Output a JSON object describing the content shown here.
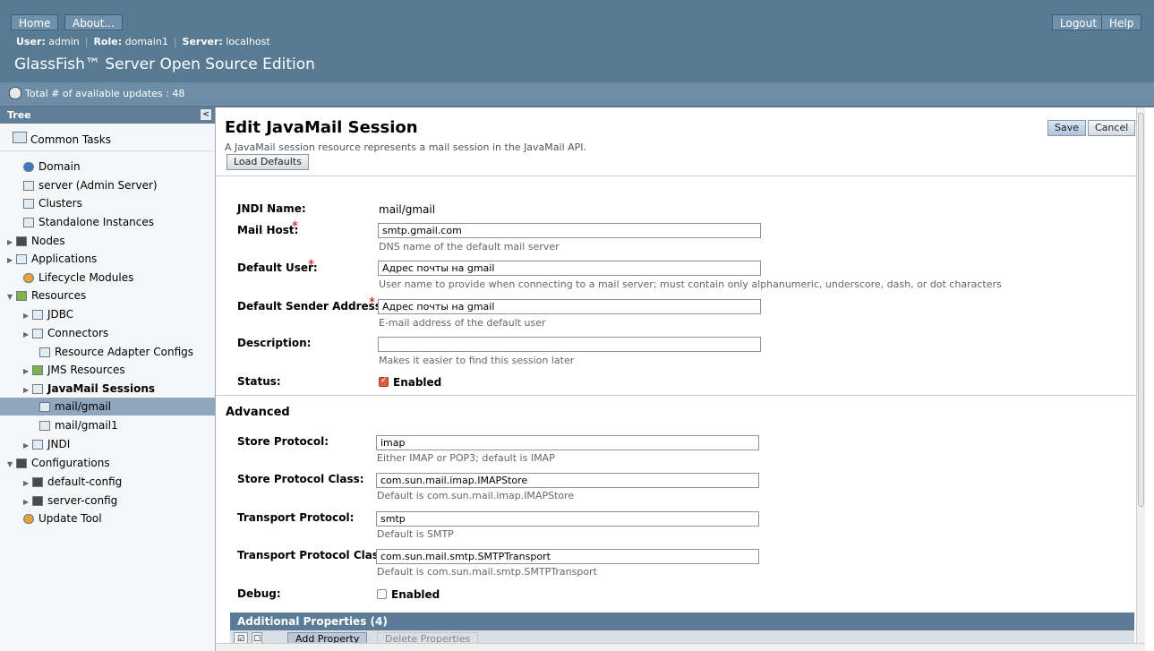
{
  "header": {
    "home": "Home",
    "about": "About...",
    "logout": "Logout",
    "help": "Help",
    "user_label": "User:",
    "user": "admin",
    "role_label": "Role:",
    "role": "domain1",
    "server_label": "Server:",
    "server": "localhost",
    "brand": "GlassFish™ Server Open Source Edition",
    "updates": "Total # of available updates : 48"
  },
  "tree": {
    "title": "Tree",
    "common_tasks": "Common Tasks",
    "items": [
      {
        "label": "Domain"
      },
      {
        "label": "server (Admin Server)"
      },
      {
        "label": "Clusters"
      },
      {
        "label": "Standalone Instances"
      },
      {
        "label": "Nodes"
      },
      {
        "label": "Applications"
      },
      {
        "label": "Lifecycle Modules"
      },
      {
        "label": "Resources"
      },
      {
        "label": "JDBC"
      },
      {
        "label": "Connectors"
      },
      {
        "label": "Resource Adapter Configs"
      },
      {
        "label": "JMS Resources"
      },
      {
        "label": "JavaMail Sessions"
      },
      {
        "label": "mail/gmail"
      },
      {
        "label": "mail/gmail1"
      },
      {
        "label": "JNDI"
      },
      {
        "label": "Configurations"
      },
      {
        "label": "default-config"
      },
      {
        "label": "server-config"
      },
      {
        "label": "Update Tool"
      }
    ]
  },
  "page": {
    "title": "Edit JavaMail Session",
    "description": "A JavaMail session resource represents a mail session in the JavaMail API.",
    "load_defaults": "Load Defaults",
    "save": "Save",
    "cancel": "Cancel"
  },
  "form": {
    "jndi_label": "JNDI Name:",
    "jndi_value": "mail/gmail",
    "mailhost_label": "Mail Host:",
    "mailhost_value": "smtp.gmail.com",
    "mailhost_help": "DNS name of the default mail server",
    "user_label": "Default User:",
    "user_value": "Адрес почты на gmail",
    "user_help": "User name to provide when connecting to a mail server; must contain only alphanumeric, underscore, dash, or dot characters",
    "sender_label": "Default Sender Address:",
    "sender_value": "Адрес почты на gmail",
    "sender_help": "E-mail address of the default user",
    "desc_label": "Description:",
    "desc_value": "",
    "desc_help": "Makes it easier to find this session later",
    "status_label": "Status:",
    "status_value": "Enabled",
    "required_mark": "*"
  },
  "advanced": {
    "title": "Advanced",
    "store_protocol_label": "Store Protocol:",
    "store_protocol_value": "imap",
    "store_protocol_help": "Either IMAP or POP3; default is IMAP",
    "store_class_label": "Store Protocol Class:",
    "store_class_value": "com.sun.mail.imap.IMAPStore",
    "store_class_help": "Default is com.sun.mail.imap.IMAPStore",
    "transport_label": "Transport Protocol:",
    "transport_value": "smtp",
    "transport_help": "Default is SMTP",
    "transport_class_label": "Transport Protocol Class:",
    "transport_class_value": "com.sun.mail.smtp.SMTPTransport",
    "transport_class_help": "Default is com.sun.mail.smtp.SMTPTransport",
    "debug_label": "Debug:",
    "debug_value": "Enabled"
  },
  "properties": {
    "title": "Additional Properties (4)",
    "add": "Add Property",
    "delete": "Delete Properties"
  }
}
